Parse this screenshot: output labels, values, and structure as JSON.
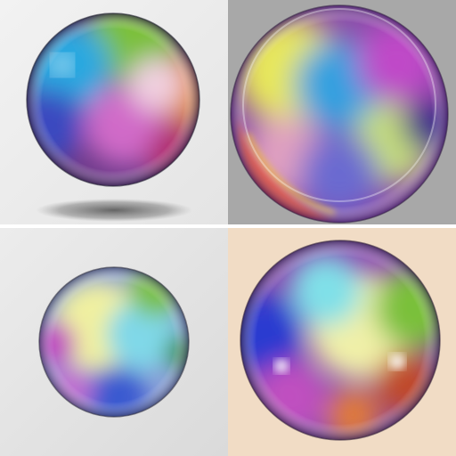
{
  "tiles": [
    {
      "id": "sphere-1",
      "background": "#ececec",
      "has_shadow": true
    },
    {
      "id": "sphere-2",
      "background": "#a8a8a8",
      "has_shadow": false
    },
    {
      "id": "sphere-3",
      "background": "#e2e2e2",
      "has_shadow": false
    },
    {
      "id": "sphere-4",
      "background": "#f1dcc5",
      "has_shadow": false
    }
  ]
}
